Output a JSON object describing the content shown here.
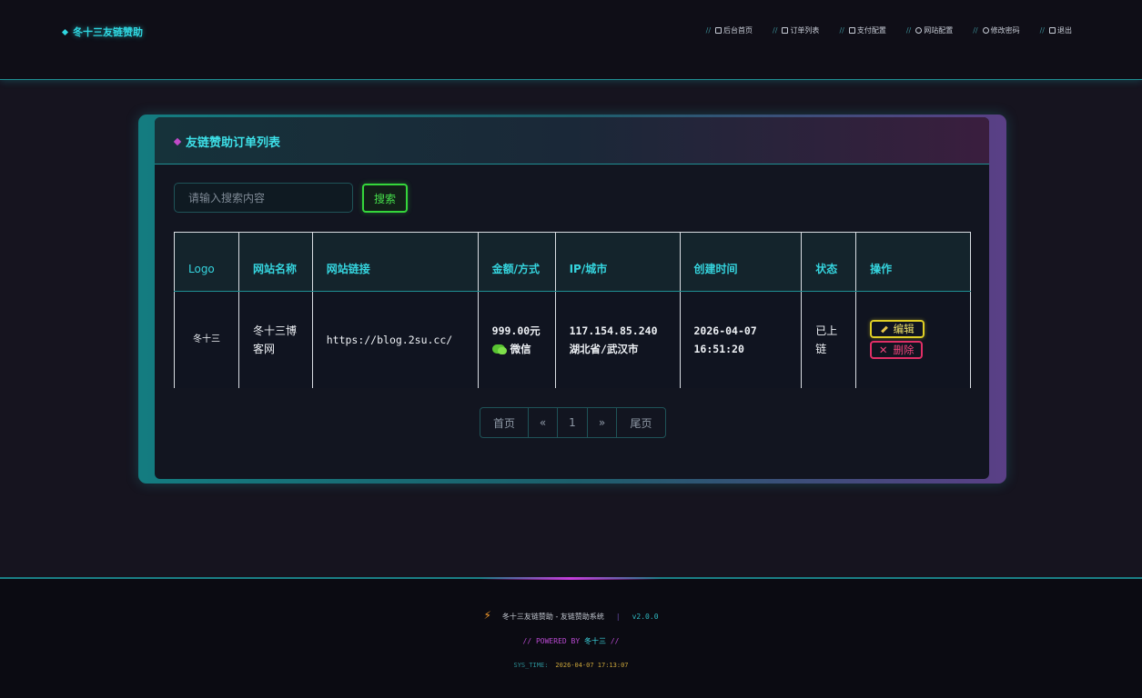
{
  "header": {
    "brand": "冬十三友链赞助",
    "nav": [
      {
        "slash": "//",
        "label": "后台首页",
        "icon": "home-icon"
      },
      {
        "slash": "//",
        "label": "订单列表",
        "icon": "list-icon"
      },
      {
        "slash": "//",
        "label": "支付配置",
        "icon": "card-icon"
      },
      {
        "slash": "//",
        "label": "网站配置",
        "icon": "globe-icon"
      },
      {
        "slash": "//",
        "label": "修改密码",
        "icon": "edit-icon"
      },
      {
        "slash": "//",
        "label": "退出",
        "icon": "logout-icon"
      }
    ]
  },
  "card": {
    "title": "友链赞助订单列表",
    "search": {
      "placeholder": "请输入搜索内容",
      "button": "搜索"
    },
    "table": {
      "headers": [
        "Logo",
        "网站名称",
        "网站链接",
        "金额/方式",
        "IP/城市",
        "创建时间",
        "状态",
        "操作"
      ],
      "rows": [
        {
          "logo": "冬十三",
          "site_name": "冬十三博客网",
          "site_link": "https://blog.2su.cc/",
          "amount": "999.00元",
          "pay_method": "微信",
          "ip": "117.154.85.240",
          "city": "湖北省/武汉市",
          "date": "2026-04-07",
          "time": "16:51:20",
          "status": "已上链",
          "edit": "编辑",
          "delete": "删除"
        }
      ]
    },
    "pagination": {
      "first": "首页",
      "prev": "«",
      "current": "1",
      "next": "»",
      "last": "尾页"
    }
  },
  "footer": {
    "title": "冬十三友链赞助 - 友链赞助系统",
    "sep": "|",
    "version": "v2.0.0",
    "powered_prefix": "// POWERED BY",
    "author": "冬十三",
    "powered_suffix": "//",
    "sys_label": "SYS_TIME:",
    "sys_time": "2026-04-07 17:13:07"
  },
  "colors": {
    "accent": "#2fd6e0",
    "magenta": "#c04ac8",
    "success": "#35d63b",
    "warn": "#e0cf25",
    "danger": "#e02f66"
  }
}
